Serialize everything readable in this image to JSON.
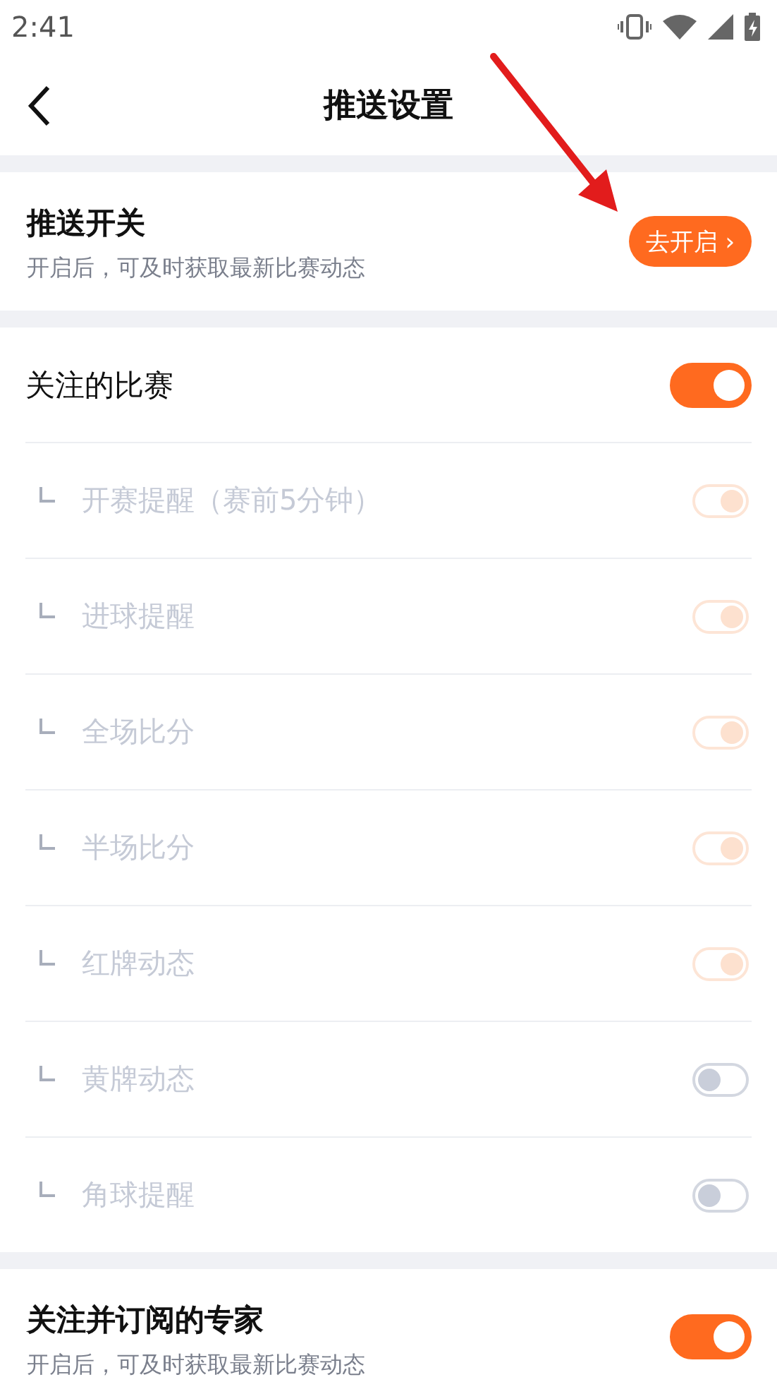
{
  "status_bar": {
    "time": "2:41"
  },
  "header": {
    "title": "推送设置"
  },
  "push": {
    "title": "推送开关",
    "subtitle": "开启后，可及时获取最新比赛动态",
    "button": "去开启 ›"
  },
  "followed": {
    "label": "关注的比赛",
    "on": true,
    "children": [
      {
        "label": "开赛提醒（赛前5分钟）",
        "on": true,
        "disabled": true
      },
      {
        "label": "进球提醒",
        "on": true,
        "disabled": true
      },
      {
        "label": "全场比分",
        "on": true,
        "disabled": true
      },
      {
        "label": "半场比分",
        "on": true,
        "disabled": true
      },
      {
        "label": "红牌动态",
        "on": true,
        "disabled": true
      },
      {
        "label": "黄牌动态",
        "on": false,
        "disabled": true
      },
      {
        "label": "角球提醒",
        "on": false,
        "disabled": true
      }
    ]
  },
  "experts": {
    "title": "关注并订阅的专家",
    "subtitle": "开启后，可及时获取最新比赛动态",
    "on": true
  }
}
